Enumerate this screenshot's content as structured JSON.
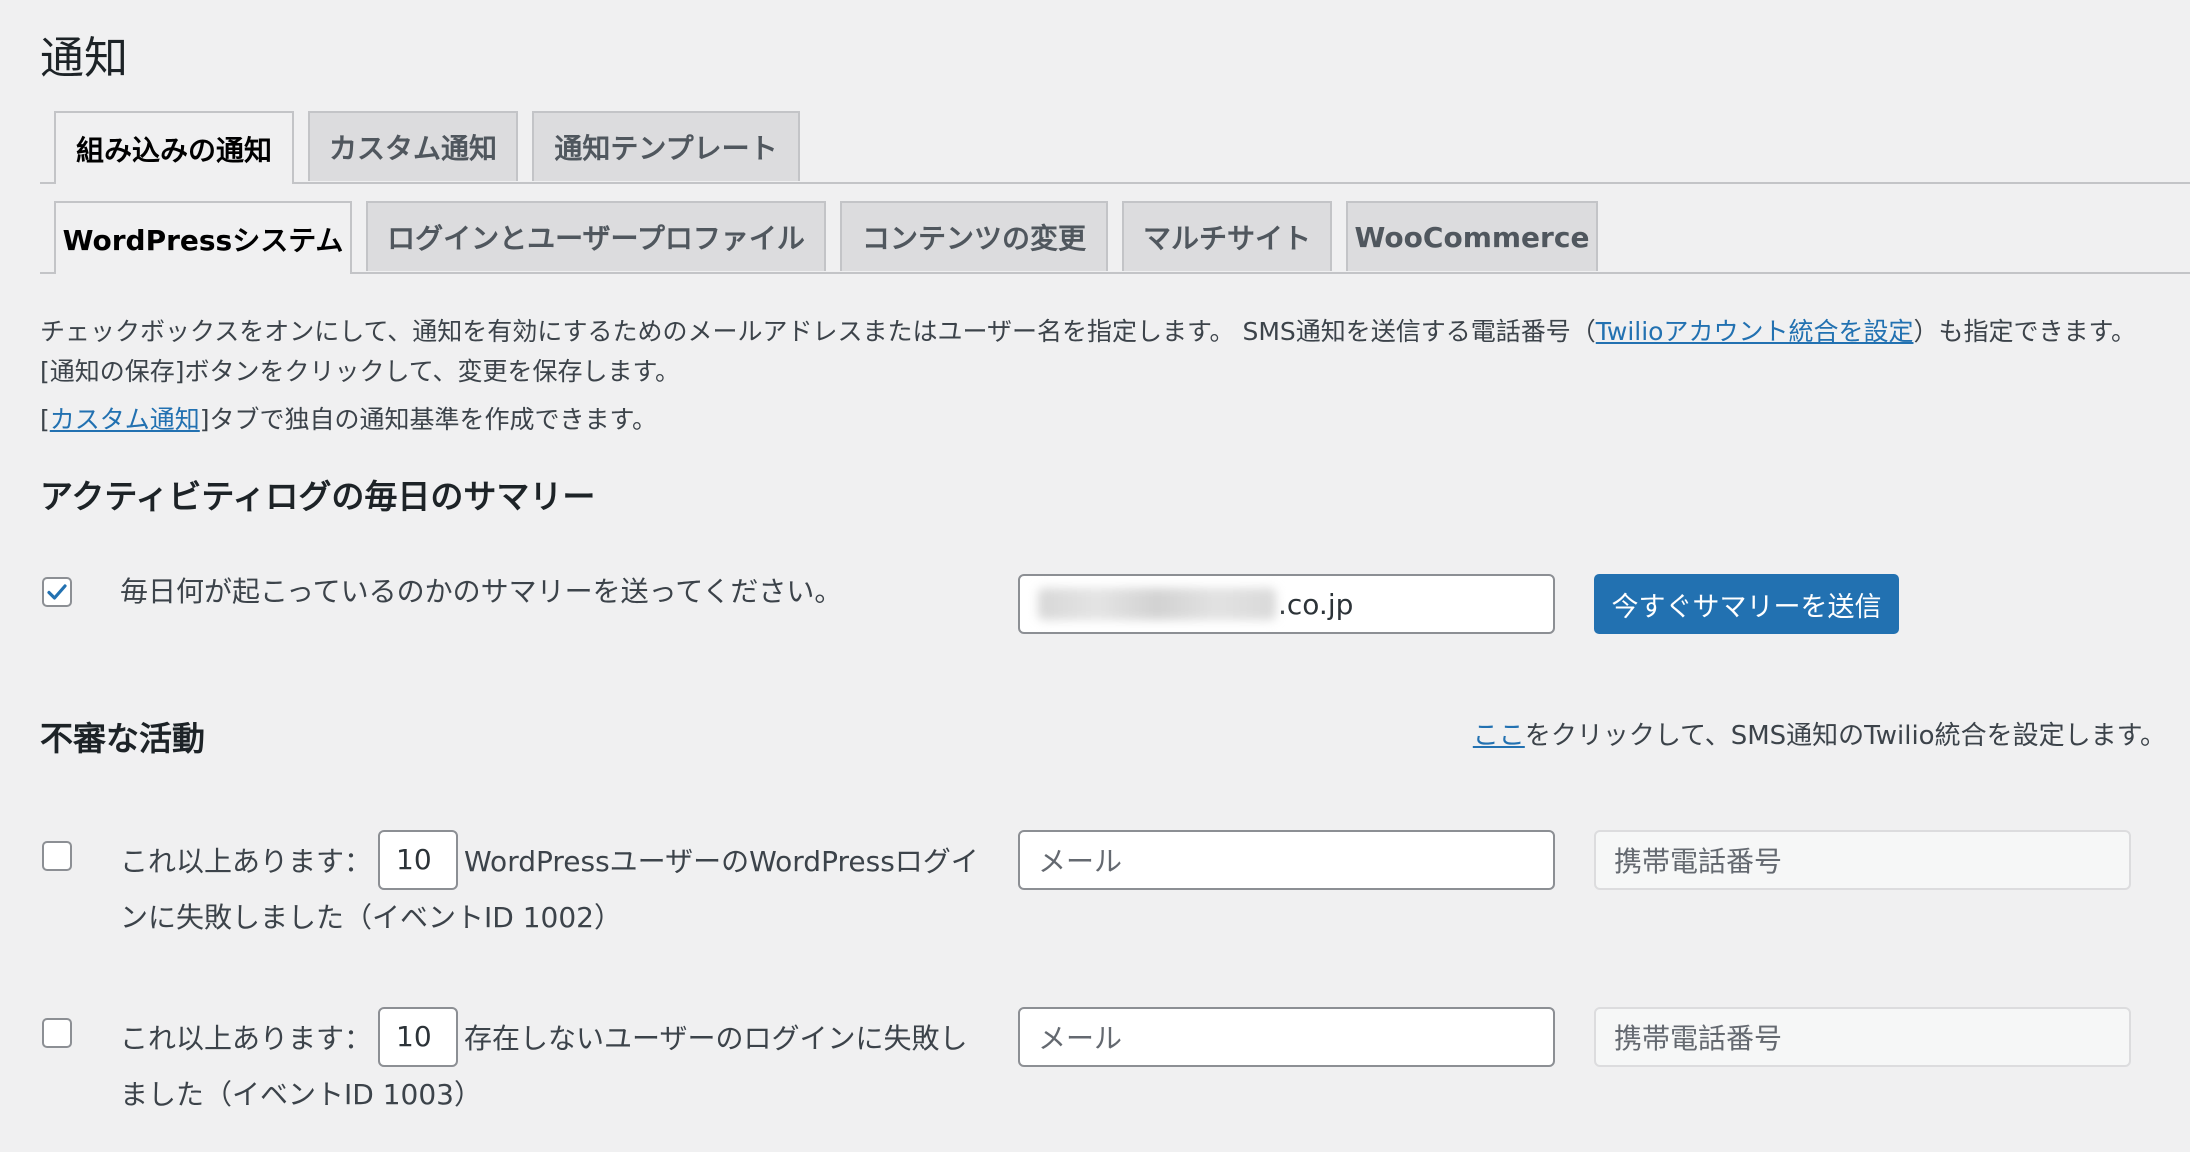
{
  "page": {
    "title": "通知"
  },
  "tabs_primary": [
    {
      "label": "組み込みの通知",
      "active": true
    },
    {
      "label": "カスタム通知",
      "active": false
    },
    {
      "label": "通知テンプレート",
      "active": false
    }
  ],
  "tabs_secondary": [
    {
      "label": "WordPressシステム",
      "active": true
    },
    {
      "label": "ログインとユーザープロファイル",
      "active": false
    },
    {
      "label": "コンテンツの変更",
      "active": false
    },
    {
      "label": "マルチサイト",
      "active": false
    },
    {
      "label": "WooCommerce",
      "active": false
    }
  ],
  "description": {
    "line1_prefix": "チェックボックスをオンにして、通知を有効にするためのメールアドレスまたはユーザー名を指定します。 SMS通知を送信する電話番号（",
    "line1_link": "Twilioアカウント統合を設定",
    "line1_suffix": "）も指定できます。 [通知の保存]ボタンをクリックして、変更を保存します。",
    "line2_open": "[",
    "line2_link": "カスタム通知",
    "line2_suffix": "]タブで独自の通知基準を作成できます。"
  },
  "daily_summary": {
    "title": "アクティビティログの毎日のサマリー",
    "checkbox_checked": true,
    "label": "毎日何が起こっているのかのサマリーを送ってください。",
    "email_visible_suffix": ".co.jp",
    "send_button": "今すぐサマリーを送信"
  },
  "suspicious": {
    "title": "不審な活動",
    "twilio_link": "ここ",
    "twilio_text": "をクリックして、SMS通知のTwilio統合を設定します。",
    "rows": [
      {
        "checked": false,
        "prefix": "これ以上あります：",
        "count": "10",
        "suffix_line1": "WordPressユーザーのWordPressログイ",
        "line2": "ンに失敗しました（イベントID 1002）",
        "email_placeholder": "メール",
        "phone_placeholder": "携帯電話番号"
      },
      {
        "checked": false,
        "prefix": "これ以上あります：",
        "count": "10",
        "suffix_line1": "存在しないユーザーのログインに失敗し",
        "line2": "ました（イベントID 1003）",
        "email_placeholder": "メール",
        "phone_placeholder": "携帯電話番号"
      }
    ]
  },
  "colors": {
    "background": "#f0f0f1",
    "accent": "#2271b1",
    "tab_inactive": "#dcdcde"
  }
}
